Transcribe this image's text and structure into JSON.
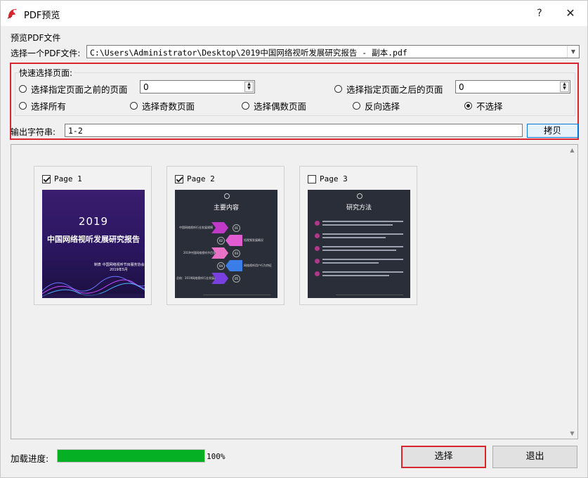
{
  "window": {
    "title": "PDF预览",
    "help": "?",
    "close": "✕"
  },
  "preview_label": "预览PDF文件",
  "file": {
    "label": "选择一个PDF文件:",
    "value": "C:\\Users\\Administrator\\Desktop\\2019中国网络视听发展研究报告 - 副本.pdf"
  },
  "quick_select": {
    "title": "快速选择页面:",
    "before": {
      "label": "选择指定页面之前的页面",
      "value": "0"
    },
    "after": {
      "label": "选择指定页面之后的页面",
      "value": "0"
    },
    "options": [
      {
        "label": "选择所有",
        "checked": false
      },
      {
        "label": "选择奇数页面",
        "checked": false
      },
      {
        "label": "选择偶数页面",
        "checked": false
      },
      {
        "label": "反向选择",
        "checked": false
      },
      {
        "label": "不选择",
        "checked": true
      }
    ]
  },
  "output": {
    "label": "输出字符串:",
    "value": "1-2",
    "copy_label": "拷贝"
  },
  "pages": [
    {
      "label": "Page 1",
      "checked": true,
      "thumb": {
        "year": "2019",
        "title": "中国网络视听发展研究报告",
        "sub1": "制表 中国网络视听节目服务协会",
        "sub2": "2019年5月"
      }
    },
    {
      "label": "Page 2",
      "checked": true,
      "thumb": {
        "title": "主要内容",
        "rows": [
          {
            "text": "中国网络视听行业发展规模",
            "num": "01"
          },
          {
            "text": "短视频发展概况",
            "num": "02"
          },
          {
            "text": "2019中国网络视听节目发展",
            "num": "03"
          },
          {
            "text": "网络视听用户行为特征",
            "num": "04"
          },
          {
            "text": "总结：2019网络视听行业发展趋势",
            "num": "05"
          }
        ]
      }
    },
    {
      "label": "Page 3",
      "checked": false,
      "thumb": {
        "title": "研究方法"
      }
    }
  ],
  "progress": {
    "label": "加载进度:",
    "value": 100,
    "text": "100%"
  },
  "buttons": {
    "select": "选择",
    "exit": "退出"
  },
  "colors": {
    "accent_red": "#d9262e",
    "progress_green": "#06b025",
    "focus_blue": "#0078d7"
  },
  "icons": {
    "app": "pdf-app-icon",
    "spin_up": "▲",
    "spin_down": "▼",
    "combo": "▼",
    "scroll_up": "▲",
    "scroll_down": "▼"
  }
}
